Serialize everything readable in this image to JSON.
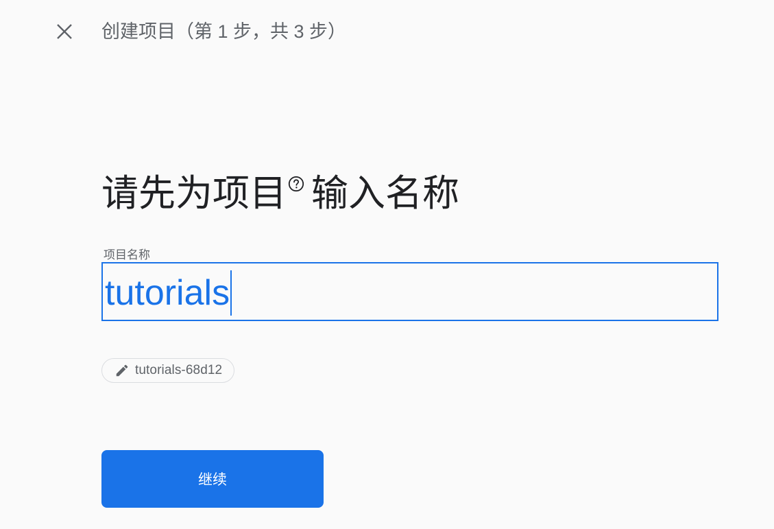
{
  "header": {
    "close_icon": "close-icon",
    "step_title": "创建项目（第 1 步，共 3 步）"
  },
  "main": {
    "heading_before": "请先为项目",
    "help_icon": "help-circle-icon",
    "heading_after": "输入名称",
    "project_name_label": "项目名称",
    "project_name_value": "tutorials",
    "project_id_chip": {
      "icon": "pencil-icon",
      "value": "tutorials-68d12"
    },
    "continue_label": "继续"
  },
  "colors": {
    "accent": "#1a73e8",
    "background": "#fafafa",
    "secondary_text": "#5f6368",
    "primary_text": "#202124"
  }
}
